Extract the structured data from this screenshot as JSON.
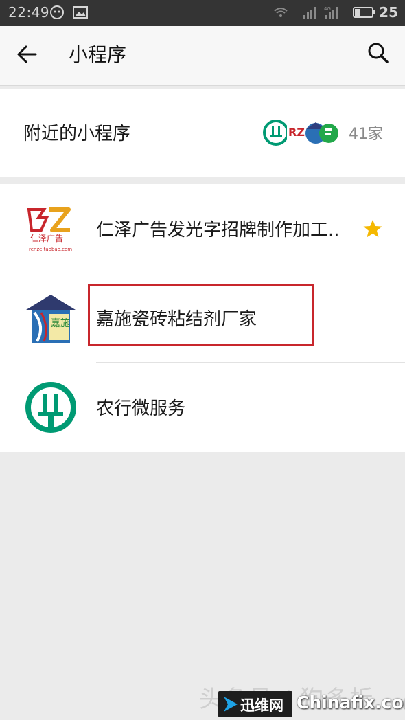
{
  "status_bar": {
    "time": "22:49",
    "battery_level": "25",
    "network_label": "4G",
    "icons": [
      "wechat-icon",
      "image-icon",
      "wifi-icon",
      "signal-icon",
      "signal-4g-icon",
      "battery-icon"
    ]
  },
  "nav": {
    "title": "小程序",
    "back_icon": "arrow-left-icon",
    "search_icon": "search-icon"
  },
  "nearby": {
    "label": "附近的小程序",
    "count": "41家"
  },
  "list": [
    {
      "name": "仁泽广告发光字招牌制作加工..",
      "starred": true,
      "logo_text": "仁泽广告",
      "logo_sub": "renze.taobao.com"
    },
    {
      "name": "嘉施瓷砖粘结剂厂家",
      "starred": false,
      "highlighted": true,
      "logo_text": "嘉施"
    },
    {
      "name": "农行微服务",
      "starred": false
    }
  ],
  "watermark": {
    "text": "头条号 / 狗多折",
    "badge": "迅维网",
    "domain": "Chinafix.com"
  },
  "colors": {
    "status_bar_bg": "#343434",
    "nav_bg": "#f7f7f7",
    "page_bg": "#ebebeb",
    "highlight_border": "#c8262c",
    "star": "#f5b800",
    "abc_green": "#009a73"
  }
}
